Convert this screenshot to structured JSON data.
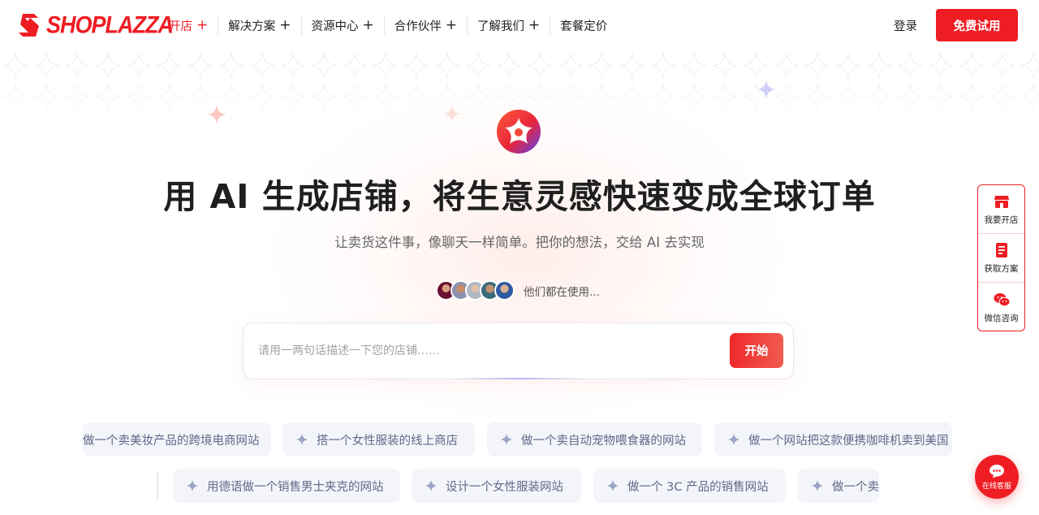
{
  "nav": {
    "brand": "SHOPLAZZA",
    "items": [
      {
        "label": "开店",
        "plus": "+",
        "active": true
      },
      {
        "label": "解决方案",
        "plus": "+"
      },
      {
        "label": "资源中心",
        "plus": "+"
      },
      {
        "label": "合作伙伴",
        "plus": "+"
      },
      {
        "label": "了解我们",
        "plus": "+"
      },
      {
        "label": "套餐定价",
        "plus": ""
      }
    ],
    "login": "登录",
    "trial": "免费试用"
  },
  "hero": {
    "headline": "用 AI 生成店铺，将生意灵感快速变成全球订单",
    "subline": "让卖货这件事，像聊天一样简单。把你的想法，交给 AI 去实现",
    "users_text": "他们都在使用...",
    "prompt_placeholder": "请用一两句话描述一下您的店铺……",
    "start": "开始"
  },
  "suggestions": {
    "row1": [
      "做一个卖美妆产品的跨境电商网站",
      "搭一个女性服装的线上商店",
      "做一个卖自动宠物喂食器的网站",
      "做一个网站把这款便携咖啡机卖到美国"
    ],
    "row2": [
      "用德语做一个销售男士夹克的网站",
      "设计一个女性服装网站",
      "做一个 3C 产品的销售网站",
      "做一个卖"
    ]
  },
  "side": {
    "items": [
      {
        "label": "我要开店",
        "icon": "store-icon"
      },
      {
        "label": "获取方案",
        "icon": "document-icon"
      },
      {
        "label": "微信咨询",
        "icon": "wechat-icon"
      }
    ],
    "chat": "在线客服"
  },
  "colors": {
    "brand": "#ee1d23",
    "chip_bg": "#f4f5fa",
    "chip_text": "#5f6888"
  }
}
